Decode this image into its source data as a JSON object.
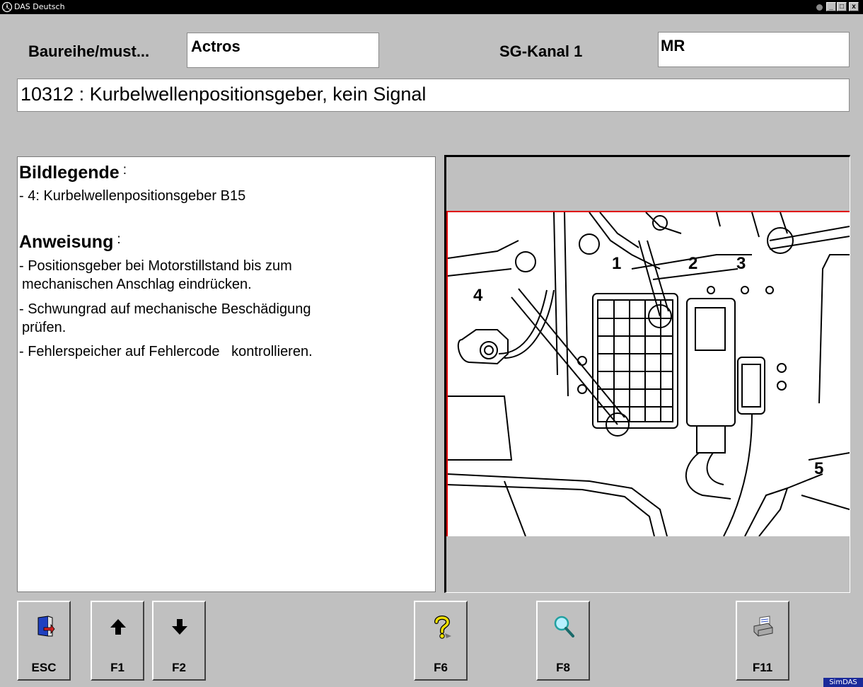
{
  "window": {
    "title": "DAS Deutsch",
    "minimize": "_",
    "maximize": "□",
    "close": "x"
  },
  "header": {
    "series_label": "Baureihe/must...",
    "series_value": "Actros",
    "channel_label": "SG-Kanal 1",
    "channel_value": "MR"
  },
  "fault": {
    "text": "10312 : Kurbelwellenpositionsgeber, kein Signal"
  },
  "legend": {
    "heading": "Bildlegende",
    "colon": ":",
    "items": [
      "- 4: Kurbelwellenpositionsgeber B15"
    ]
  },
  "instructions": {
    "heading": "Anweisung",
    "colon": ":",
    "lines": [
      "- Positionsgeber bei Motorstillstand bis zum",
      "  mechanischen Anschlag eindrücken.",
      "- Schwungrad auf mechanische Beschädigung",
      "  prüfen.",
      "- Fehlerspeicher auf Fehlercode   kontrollieren."
    ]
  },
  "diagram": {
    "callouts": [
      "1",
      "2",
      "3",
      "4",
      "5"
    ]
  },
  "buttons": [
    {
      "key": "ESC",
      "icon": "exit-door-icon"
    },
    {
      "key": "F1",
      "icon": "arrow-up-icon"
    },
    {
      "key": "F2",
      "icon": "arrow-down-icon"
    },
    {
      "key": "F6",
      "icon": "help-question-icon"
    },
    {
      "key": "F8",
      "icon": "magnifier-icon"
    },
    {
      "key": "F11",
      "icon": "printer-icon"
    }
  ],
  "badge": "SimDAS",
  "colors": {
    "background": "#c0c0c0",
    "diagram_border": "#e00000",
    "help_icon": "#f0e000",
    "badge": "#1a2a9a"
  }
}
